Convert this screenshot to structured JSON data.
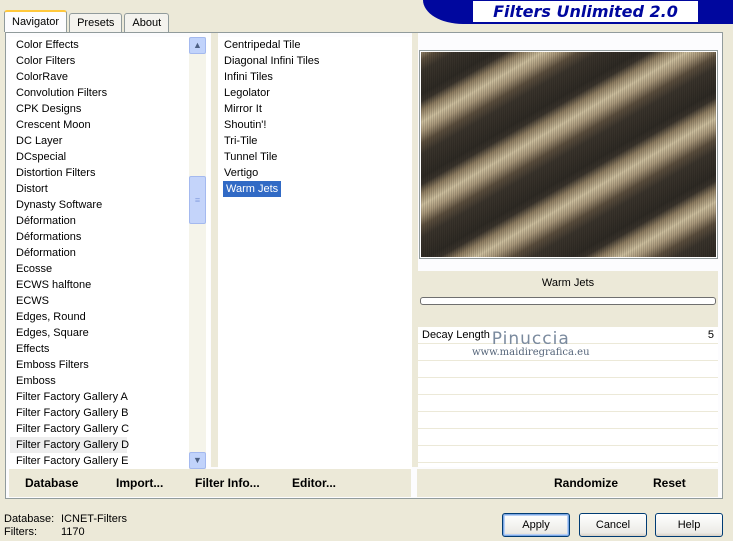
{
  "tabs": [
    {
      "label": "Navigator",
      "active": true
    },
    {
      "label": "Presets",
      "active": false
    },
    {
      "label": "About",
      "active": false
    }
  ],
  "banner": {
    "title": "Filters Unlimited 2.0"
  },
  "categories": [
    "Color Effects",
    "Color Filters",
    "ColorRave",
    "Convolution Filters",
    "CPK Designs",
    "Crescent Moon",
    "DC Layer",
    "DCspecial",
    "Distortion Filters",
    "Distort",
    "Dynasty Software",
    "Déformation",
    "Déformations",
    "Déformation",
    "Ecosse",
    "ECWS halftone",
    "ECWS",
    "Edges, Round",
    "Edges, Square",
    "Effects",
    "Emboss Filters",
    "Emboss",
    "Filter Factory Gallery A",
    "Filter Factory Gallery B",
    "Filter Factory Gallery C",
    "Filter Factory Gallery D",
    "Filter Factory Gallery E"
  ],
  "selected_category": "Filter Factory Gallery D",
  "filters": [
    "Centripedal Tile",
    "Diagonal Infini Tiles",
    "Infini Tiles",
    "Legolator",
    "Mirror It",
    "Shoutin'!",
    "Tri-Tile",
    "Tunnel Tile",
    "Vertigo",
    "Warm Jets"
  ],
  "selected_filter": "Warm Jets",
  "preview": {
    "filter_name": "Warm Jets"
  },
  "params": [
    {
      "label": "Decay Length",
      "value": "5"
    }
  ],
  "watermark": {
    "line1": "Pinuccia",
    "line2": "www.maidiregrafica.eu"
  },
  "toolbar": {
    "database": "Database",
    "import": "Import...",
    "filter_info": "Filter Info...",
    "editor": "Editor...",
    "randomize": "Randomize",
    "reset": "Reset"
  },
  "footer": {
    "database_label": "Database:",
    "database_value": "ICNET-Filters",
    "filters_label": "Filters:",
    "filters_value": "1170"
  },
  "buttons": {
    "apply": "Apply",
    "cancel": "Cancel",
    "help": "Help"
  },
  "colors": {
    "banner": "#00079e",
    "selection": "#316ac5",
    "panel": "#ece9d8"
  }
}
